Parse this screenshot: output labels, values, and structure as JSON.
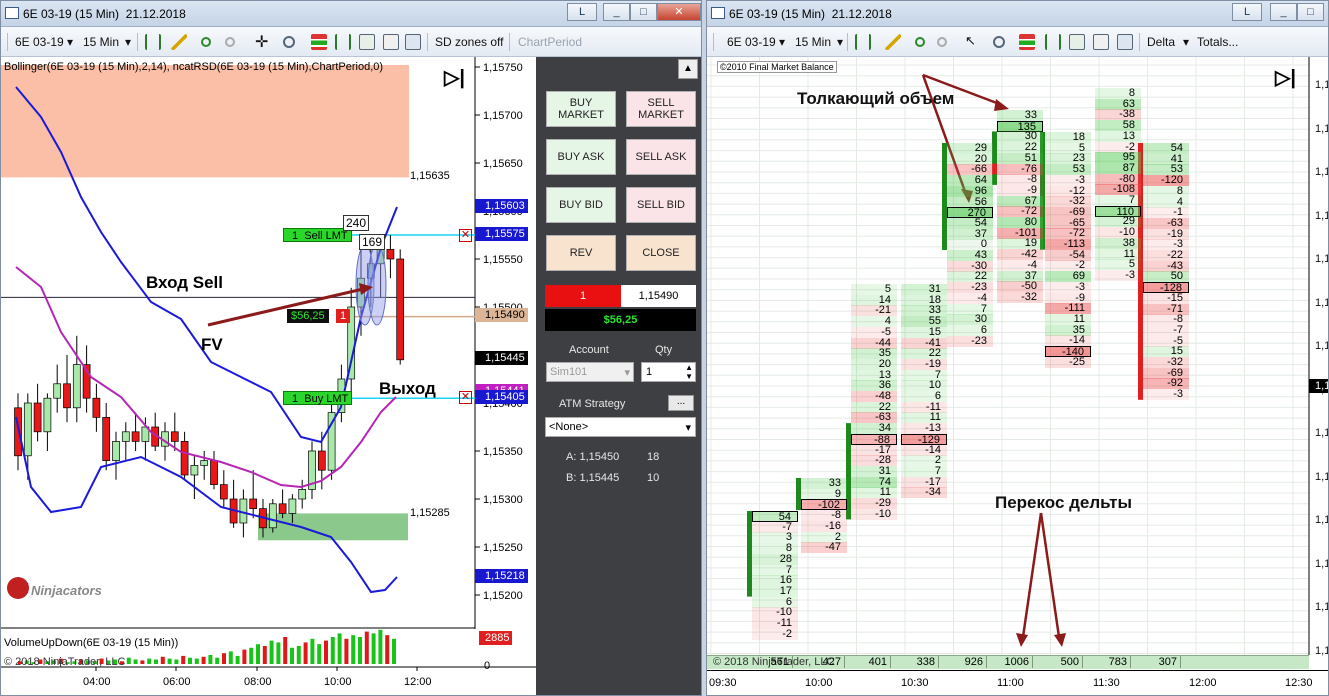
{
  "win1": {
    "title": "6E 03-19 (15 Min)  21.12.2018",
    "btn_l": "L",
    "toolbar": {
      "instrument": "6E 03-19",
      "period": "15 Min",
      "sd_zones": "SD zones off",
      "chart_period": "ChartPeriod"
    },
    "indicator_label": "Bollinger(6E 03-19 (15 Min),2,14), ncatRSD(6E 03-19 (15 Min),ChartPeriod,0)",
    "y_ticks": [
      "1,15750",
      "1,15700",
      "1,15650",
      "1,15600",
      "1,15550",
      "1,15500",
      "1,15450",
      "1,15400",
      "1,15350",
      "1,15300",
      "1,15250",
      "1,15200"
    ],
    "zone_top_price": "1,15635",
    "zone_bottom_price": "1,15285",
    "price_flags": {
      "blue_top": "1,15603",
      "sell_lmt": "1,15575",
      "avg": "1,15490",
      "last": "1,15445",
      "magenta": "1,15441",
      "buy_lmt": "1,15405",
      "blue_bottom": "1,15218"
    },
    "orders": {
      "sell_qty": "1",
      "sell_label": "Sell LMT",
      "buy_qty": "1",
      "buy_label": "Buy LMT",
      "pos_pnl": "$56,25",
      "pos_qty": "1",
      "label_240": "240",
      "label_169": "169"
    },
    "annotations": {
      "entry_sell": "Вход Sell",
      "fv": "FV",
      "exit": "Выход"
    },
    "brand": "Ninjacators",
    "volume_label": "VolumeUpDown(6E 03-19 (15 Min))",
    "volume_value": "2885",
    "volume_zero": "0",
    "copyright": "© 2018 NinjaTrader, LLC",
    "x_ticks": [
      "04:00",
      "06:00",
      "08:00",
      "10:00",
      "12:00"
    ],
    "vol_bars": [
      3,
      4,
      2,
      5,
      3,
      4,
      6,
      2,
      3,
      5,
      4,
      3,
      6,
      4,
      5,
      3,
      7,
      5,
      4,
      6,
      5,
      8,
      6,
      5,
      9,
      7,
      6,
      8,
      10,
      7,
      12,
      14,
      9,
      16,
      18,
      22,
      20,
      26,
      24,
      30,
      18,
      20,
      24,
      28,
      22,
      26,
      30,
      34,
      28,
      32,
      30,
      36,
      34,
      38,
      32,
      28
    ],
    "candles": [
      {
        "o": 1.15395,
        "h": 1.1541,
        "l": 1.1533,
        "c": 1.15345
      },
      {
        "o": 1.15345,
        "h": 1.1541,
        "l": 1.1532,
        "c": 1.154
      },
      {
        "o": 1.154,
        "h": 1.1542,
        "l": 1.1536,
        "c": 1.1537
      },
      {
        "o": 1.1537,
        "h": 1.1541,
        "l": 1.1535,
        "c": 1.15405
      },
      {
        "o": 1.15405,
        "h": 1.1544,
        "l": 1.1539,
        "c": 1.1542
      },
      {
        "o": 1.1542,
        "h": 1.1545,
        "l": 1.1538,
        "c": 1.15395
      },
      {
        "o": 1.15395,
        "h": 1.1547,
        "l": 1.1538,
        "c": 1.1544
      },
      {
        "o": 1.1544,
        "h": 1.1546,
        "l": 1.1539,
        "c": 1.15405
      },
      {
        "o": 1.15405,
        "h": 1.1542,
        "l": 1.1537,
        "c": 1.15385
      },
      {
        "o": 1.15385,
        "h": 1.154,
        "l": 1.1533,
        "c": 1.1534
      },
      {
        "o": 1.1534,
        "h": 1.1537,
        "l": 1.1532,
        "c": 1.1536
      },
      {
        "o": 1.1536,
        "h": 1.1538,
        "l": 1.1534,
        "c": 1.1537
      },
      {
        "o": 1.1537,
        "h": 1.1539,
        "l": 1.1535,
        "c": 1.1536
      },
      {
        "o": 1.1536,
        "h": 1.15385,
        "l": 1.1534,
        "c": 1.15375
      },
      {
        "o": 1.15375,
        "h": 1.1539,
        "l": 1.1535,
        "c": 1.15355
      },
      {
        "o": 1.15355,
        "h": 1.1538,
        "l": 1.1534,
        "c": 1.1537
      },
      {
        "o": 1.1537,
        "h": 1.1539,
        "l": 1.1535,
        "c": 1.1536
      },
      {
        "o": 1.1536,
        "h": 1.1537,
        "l": 1.1532,
        "c": 1.15325
      },
      {
        "o": 1.15325,
        "h": 1.15345,
        "l": 1.153,
        "c": 1.15335
      },
      {
        "o": 1.15335,
        "h": 1.1535,
        "l": 1.1532,
        "c": 1.1534
      },
      {
        "o": 1.1534,
        "h": 1.1535,
        "l": 1.1531,
        "c": 1.15315
      },
      {
        "o": 1.15315,
        "h": 1.1533,
        "l": 1.1529,
        "c": 1.153
      },
      {
        "o": 1.153,
        "h": 1.1532,
        "l": 1.1527,
        "c": 1.15275
      },
      {
        "o": 1.15275,
        "h": 1.1531,
        "l": 1.1526,
        "c": 1.153
      },
      {
        "o": 1.153,
        "h": 1.1533,
        "l": 1.1528,
        "c": 1.1529
      },
      {
        "o": 1.1529,
        "h": 1.153,
        "l": 1.1526,
        "c": 1.1527
      },
      {
        "o": 1.1527,
        "h": 1.153,
        "l": 1.15265,
        "c": 1.15295
      },
      {
        "o": 1.15295,
        "h": 1.1531,
        "l": 1.1528,
        "c": 1.15285
      },
      {
        "o": 1.15285,
        "h": 1.15305,
        "l": 1.15275,
        "c": 1.153
      },
      {
        "o": 1.153,
        "h": 1.1532,
        "l": 1.1529,
        "c": 1.1531
      },
      {
        "o": 1.1531,
        "h": 1.1536,
        "l": 1.153,
        "c": 1.1535
      },
      {
        "o": 1.1535,
        "h": 1.1537,
        "l": 1.1531,
        "c": 1.1533
      },
      {
        "o": 1.1533,
        "h": 1.154,
        "l": 1.1532,
        "c": 1.1539
      },
      {
        "o": 1.1539,
        "h": 1.1544,
        "l": 1.1538,
        "c": 1.15425
      },
      {
        "o": 1.15425,
        "h": 1.1552,
        "l": 1.1541,
        "c": 1.155
      },
      {
        "o": 1.155,
        "h": 1.1556,
        "l": 1.1547,
        "c": 1.1553
      },
      {
        "o": 1.1553,
        "h": 1.1557,
        "l": 1.155,
        "c": 1.15545
      },
      {
        "o": 1.15545,
        "h": 1.15575,
        "l": 1.1551,
        "c": 1.1556
      },
      {
        "o": 1.1556,
        "h": 1.15575,
        "l": 1.1553,
        "c": 1.1555
      },
      {
        "o": 1.1555,
        "h": 1.1556,
        "l": 1.1544,
        "c": 1.15445
      }
    ]
  },
  "panel": {
    "buy_market": "BUY\nMARKET",
    "sell_market": "SELL\nMARKET",
    "buy_ask": "BUY ASK",
    "sell_ask": "SELL ASK",
    "buy_bid": "BUY BID",
    "sell_bid": "SELL BID",
    "rev": "REV",
    "close": "CLOSE",
    "pos_qty": "1",
    "pos_price": "1,15490",
    "pnl": "$56,25",
    "account_label": "Account",
    "qty_label": "Qty",
    "account_value": "Sim101",
    "qty_value": "1",
    "atm_label": "ATM Strategy",
    "atm_btn": "...",
    "atm_value": "<None>",
    "ask_line": "A: 1,15450",
    "ask_size": "18",
    "bid_line": "B: 1,15445",
    "bid_size": "10",
    "scroll_up": "▲"
  },
  "win2": {
    "title": "6E 03-19 (15 Min)  21.12.2018",
    "btn_l": "L",
    "toolbar": {
      "instrument": "6E 03-19",
      "period": "15 Min",
      "delta": "Delta",
      "totals": "Totals..."
    },
    "credit": "©2010 Final Market Balance",
    "ann_push": "Толкающий объем",
    "ann_skew": "Перекос дельты",
    "copyright": "© 2018 NinjaTrader, LLC",
    "totals": [
      "561",
      "427",
      "401",
      "338",
      "926",
      "1006",
      "500",
      "783",
      "307"
    ],
    "x_ticks": [
      "09:30",
      "10:00",
      "10:30",
      "11:00",
      "11:30",
      "12:00",
      "12:30"
    ],
    "y_label": "1,1",
    "y_last": "1,1",
    "columns": [
      {
        "top": 454,
        "cells": [
          "54",
          "-7",
          "3",
          "8",
          "28",
          "7",
          "16",
          "17",
          "6",
          "-10",
          "-11",
          "-2"
        ]
      },
      {
        "top": 421,
        "cells": [
          "33",
          "9",
          "-102",
          "-8",
          "-16",
          "2",
          "-47"
        ]
      },
      {
        "top": 227,
        "cells": [
          "5",
          "14",
          "-21",
          "4",
          "-5",
          "-44",
          "35",
          "20",
          "13",
          "36",
          "-48",
          "22",
          "-63",
          "34",
          "-88",
          "-17",
          "-28",
          "31",
          "74",
          "11",
          "-29",
          "-10"
        ]
      },
      {
        "top": 227,
        "cells": [
          "31",
          "18",
          "33",
          "55",
          "15",
          "-41",
          "22",
          "-19",
          "7",
          "10",
          "6",
          "-11",
          "11",
          "-13",
          "-129",
          "-14",
          "2",
          "7",
          "-17",
          "-34"
        ]
      },
      {
        "top": 86,
        "cells": [
          "29",
          "20",
          "-66",
          "64",
          "96",
          "56",
          "270",
          "54",
          "37",
          "0",
          "43",
          "-30",
          "22",
          "-23",
          "-4",
          "7",
          "30",
          "6",
          "-23"
        ]
      },
      {
        "top": 53,
        "cells": [
          "33",
          "135",
          "30",
          "22",
          "51",
          "-76",
          "-8",
          "-9",
          "67",
          "-72",
          "80",
          "-101",
          "19",
          "-42",
          "-4",
          "37",
          "-50",
          "-32"
        ]
      },
      {
        "top": 75,
        "cells": [
          "18",
          "5",
          "23",
          "53",
          "-3",
          "-12",
          "-32",
          "-69",
          "-65",
          "-72",
          "-113",
          "-54",
          "-2",
          "69",
          "-3",
          "-9",
          "-111",
          "11",
          "35",
          "-14",
          "-140",
          "-25"
        ]
      },
      {
        "top": 31,
        "cells": [
          "8",
          "63",
          "-38",
          "58",
          "13",
          "-2",
          "95",
          "87",
          "-80",
          "-108",
          "7",
          "110",
          "29",
          "-10",
          "38",
          "11",
          "5",
          "-3"
        ]
      },
      {
        "top": 86,
        "cells": [
          "54",
          "41",
          "53",
          "-120",
          "8",
          "4",
          "-1",
          "-63",
          "-19",
          "-3",
          "-22",
          "-43",
          "50",
          "-128",
          "-15",
          "-71",
          "-8",
          "-7",
          "-5",
          "15",
          "-32",
          "-69",
          "-92",
          "-3"
        ]
      }
    ],
    "boxed": [
      [
        0,
        0
      ],
      [
        1,
        2
      ],
      [
        2,
        14
      ],
      [
        3,
        14
      ],
      [
        4,
        6
      ],
      [
        5,
        1
      ],
      [
        6,
        20
      ],
      [
        7,
        11
      ],
      [
        8,
        13
      ]
    ],
    "bars": [
      {
        "col": 0,
        "from": 0,
        "to": 7,
        "color": "#1e8a1e"
      },
      {
        "col": 1,
        "from": 0,
        "to": 2,
        "color": "#1e8a1e"
      },
      {
        "col": 2,
        "from": 13,
        "to": 21,
        "color": "#1e8a1e"
      },
      {
        "col": 4,
        "from": 0,
        "to": 9,
        "color": "#1e8a1e"
      },
      {
        "col": 5,
        "from": 2,
        "to": 6,
        "color": "#1e8a1e"
      },
      {
        "col": 5,
        "from": 5,
        "to": 5,
        "color": "#e02020"
      },
      {
        "col": 6,
        "from": 0,
        "to": 10,
        "color": "#1e8a1e"
      },
      {
        "col": 8,
        "from": 0,
        "to": 23,
        "color": "#e02020"
      }
    ]
  }
}
